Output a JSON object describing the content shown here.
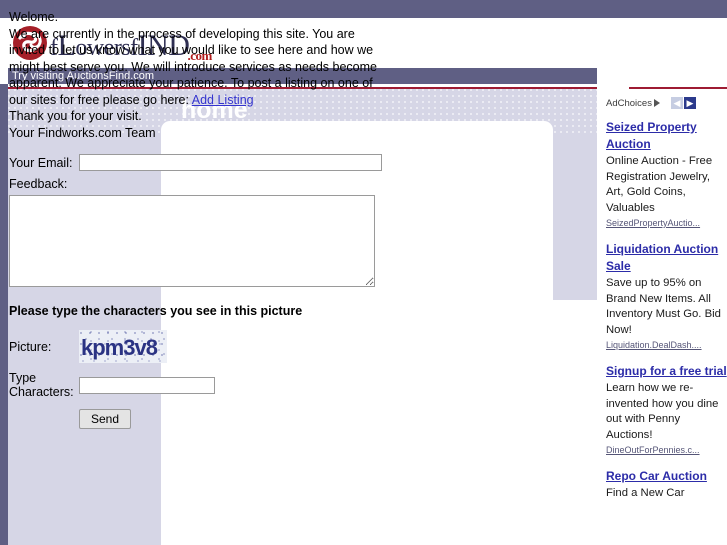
{
  "site": {
    "logo_text_part1": "f",
    "logo_text_part2": "L",
    "logo_text_part3": "owersf",
    "logo_text_part4": "IND",
    "logo_dotcom": ".com",
    "logo_icon": "flower-circle-logo"
  },
  "nav": {
    "promo_text": "Try visiting AuctionsFind.com"
  },
  "page": {
    "title": "home"
  },
  "welcome": {
    "line1": "Welome.",
    "paragraph": "We are currently in the process of developing this site. You are invited to let us know what you would like to see here and how we might best serve you. We will introduce services as needs become apparent. We appreciate your patience. To post a listing on one of our sites for free please go here: ",
    "link_label": "Add Listing",
    "line_thanks": "Thank you for your visit.",
    "line_team": "Your Findworks.com Team"
  },
  "form": {
    "email_label": "Your Email:",
    "email_value": "",
    "email_placeholder": "",
    "feedback_label": "Feedback:",
    "feedback_value": "",
    "feedback_placeholder": "",
    "captcha_heading": "Please type the characters you see in this picture",
    "picture_label": "Picture:",
    "captcha_text": "kpm3v8",
    "type_label": "Type Characters:",
    "captcha_value": "",
    "captcha_placeholder": "",
    "send_label": "Send"
  },
  "ads": {
    "adchoices_label": "AdChoices",
    "adchoices_icon": "adchoices-triangle-icon",
    "prev_icon": "chevron-left-icon",
    "next_icon": "chevron-right-icon",
    "prev_glyph": "◀",
    "next_glyph": "▶",
    "items": [
      {
        "title": "Seized Property Auction",
        "desc": "Online Auction - Free Registration Jewelry, Art, Gold Coins, Valuables",
        "url": "SeizedPropertyAuctio..."
      },
      {
        "title": "Liquidation Auction Sale",
        "desc": "Save up to 95% on Brand New Items. All Inventory Must Go. Bid Now!",
        "url": "Liquidation.DealDash...."
      },
      {
        "title": "Signup for a free trial",
        "desc": "Learn how we re-invented how you dine out with Penny Auctions!",
        "url": "DineOutForPennies.c..."
      },
      {
        "title": "Repo Car Auction",
        "desc": "Find a New Car",
        "url": ""
      }
    ]
  },
  "colors": {
    "band_purple": "#5f5f84",
    "lavender": "#d6d6e6",
    "red_rule": "#9e1b32",
    "logo_navy": "#2f2f52",
    "logo_red": "#b01c1c",
    "link_blue": "#3434cf",
    "ad_link": "#2c2ca8",
    "captcha_navy": "#2b3383"
  }
}
